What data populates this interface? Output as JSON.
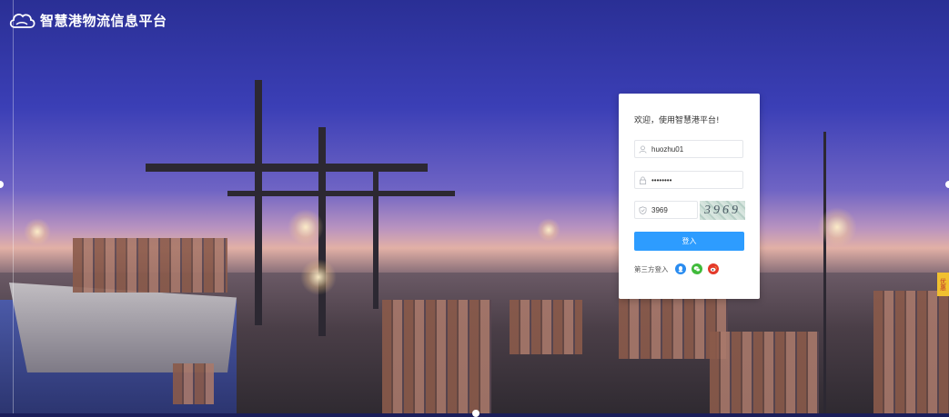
{
  "brand": {
    "name": "智慧港物流信息平台",
    "icon": "cloud-logo-icon"
  },
  "login": {
    "welcome": "欢迎，使用智慧港平台!",
    "username": "huozhu01",
    "password": "••••••••",
    "captcha_input": "3969",
    "captcha_image": "3969",
    "submit_label": "登入",
    "third_party_label": "第三方登入",
    "accent": "#2d9cff"
  },
  "social": [
    {
      "name": "qq-icon",
      "color": "#2a8cf0"
    },
    {
      "name": "wechat-icon",
      "color": "#3fba3a"
    },
    {
      "name": "weibo-icon",
      "color": "#e4392a"
    }
  ],
  "side_tag": "优惠"
}
